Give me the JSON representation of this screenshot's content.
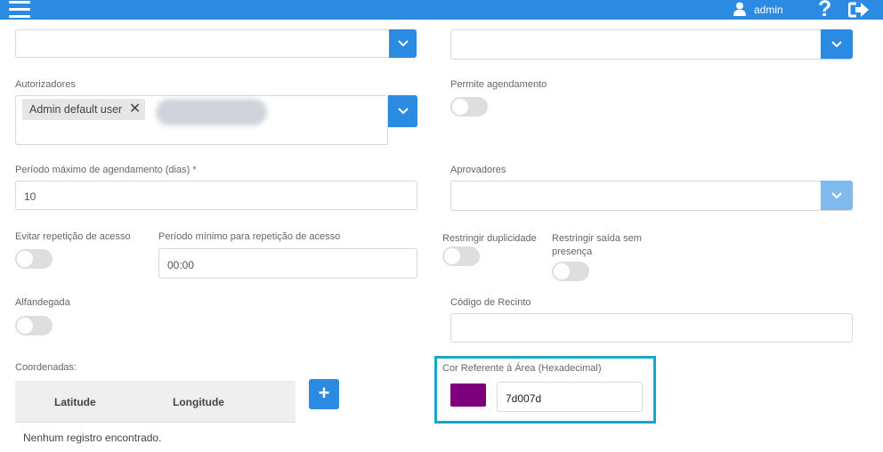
{
  "header": {
    "user_name": "admin",
    "help_glyph": "?"
  },
  "form": {
    "autorizadores": {
      "label": "Autorizadores",
      "chip": "Admin default user",
      "chip_remove": "✕"
    },
    "permite_agendamento": {
      "label": "Permite agendamento",
      "checked": false
    },
    "periodo_maximo": {
      "label": "Período máximo de agendamento (dias) *",
      "value": "10"
    },
    "aprovadores": {
      "label": "Aprovadores"
    },
    "evitar_repeticao": {
      "label": "Evitar repetição de acesso",
      "checked": false
    },
    "periodo_minimo": {
      "label": "Período mínimo para repetição de acesso",
      "value": "00:00"
    },
    "restringir_duplicidade": {
      "label": "Restringir duplicidade",
      "checked": false
    },
    "restringir_saida": {
      "label_line1": "Restringir saída sem",
      "label_line2": "presença",
      "checked": false
    },
    "alfandegada": {
      "label": "Alfandegada",
      "checked": false
    },
    "codigo_recinto": {
      "label": "Código de Recinto",
      "value": ""
    },
    "coordenadas": {
      "label": "Coordenadas:",
      "columns": [
        "Latitude",
        "Longitude"
      ],
      "empty_message": "Nenhum registro encontrado.",
      "add_glyph": "+"
    },
    "cor_area": {
      "label": "Cor Referente à Área (Hexadecimal)",
      "value": "7d007d",
      "swatch_color": "#7d007d"
    }
  },
  "colors": {
    "primary": "#2b8be3",
    "highlight_border": "#19a7c9"
  },
  "icons": [
    "menu-icon",
    "user-icon",
    "help-icon",
    "logout-icon",
    "chevron-down-icon",
    "close-icon",
    "plus-icon"
  ]
}
